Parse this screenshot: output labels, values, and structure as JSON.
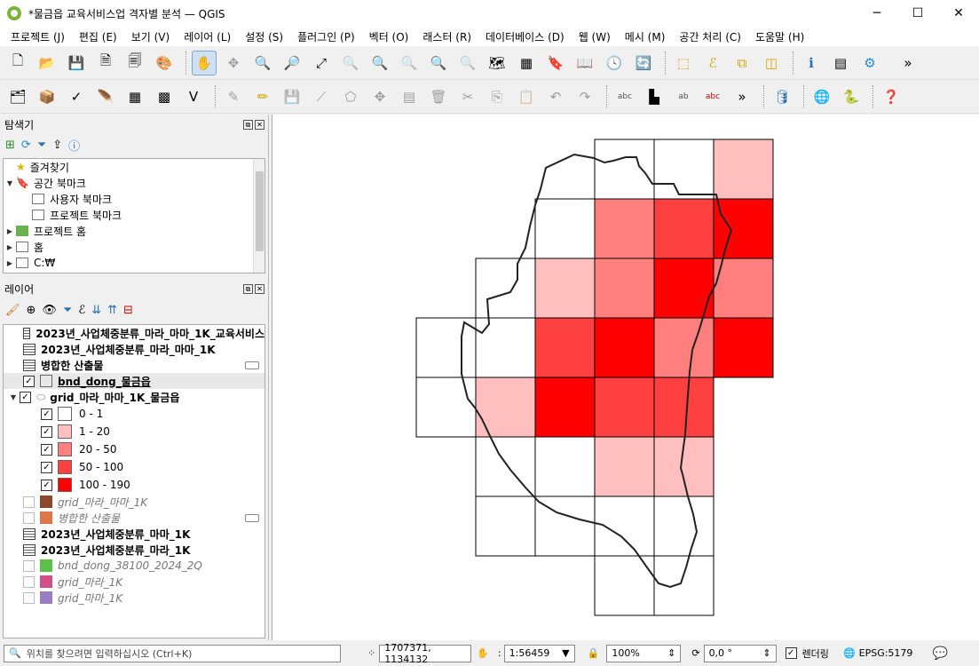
{
  "window": {
    "title": "*물금읍 교육서비스업 격자별 분석 — QGIS"
  },
  "menu": [
    "프로젝트 (J)",
    "편집 (E)",
    "보기 (V)",
    "레이어 (L)",
    "설정 (S)",
    "플러그인 (P)",
    "벡터 (O)",
    "래스터 (R)",
    "데이터베이스 (D)",
    "웹 (W)",
    "메시 (M)",
    "공간 처리 (C)",
    "도움말 (H)"
  ],
  "browser_panel": {
    "title": "탐색기",
    "items": [
      "즐겨찾기",
      "공간 북마크",
      "사용자 북마크",
      "프로젝트 북마크",
      "프로젝트 홈",
      "홈",
      "C:₩"
    ]
  },
  "layers_panel": {
    "title": "레이어",
    "layers": [
      {
        "name": "2023년_사업체중분류_마라_마마_1K_교육서비스",
        "style": "bold"
      },
      {
        "name": "2023년_사업체중분류_마라_마마_1K",
        "style": "bold"
      },
      {
        "name": "병합한 산출물",
        "style": "bold"
      },
      {
        "name": "bnd_dong_물금읍",
        "style": "bold-underline"
      },
      {
        "name": "grid_마라_마마_1K_물금읍",
        "style": "bold"
      },
      {
        "name": "grid_마라_마마_1K",
        "style": "italic",
        "color": "#8b4a2b"
      },
      {
        "name": "병합한 산출물",
        "style": "italic",
        "color": "#e0744a"
      },
      {
        "name": "2023년_사업체중분류_마마_1K",
        "style": "bold"
      },
      {
        "name": "2023년_사업체중분류_마라_1K",
        "style": "bold"
      },
      {
        "name": "bnd_dong_38100_2024_2Q",
        "style": "italic",
        "color": "#5cc04a"
      },
      {
        "name": "grid_마라_1K",
        "style": "italic",
        "color": "#d0508a"
      },
      {
        "name": "grid_마마_1K",
        "style": "italic",
        "color": "#9b7ec2"
      }
    ],
    "legend": [
      {
        "label": "0 - 1",
        "color": "#ffffff"
      },
      {
        "label": "1 - 20",
        "color": "#ffbfbf"
      },
      {
        "label": "20 - 50",
        "color": "#ff7f7f"
      },
      {
        "label": "50 - 100",
        "color": "#ff4040"
      },
      {
        "label": "100 - 190",
        "color": "#ff0000"
      }
    ]
  },
  "status": {
    "locator_placeholder": "위치를 찾으려면 입력하십시오 (Ctrl+K)",
    "coordinate": "1707371, 1134132",
    "scale": "1:56459",
    "magnifier": "100%",
    "rotation": "0,0 °",
    "render_label": "렌더링",
    "crs": "EPSG:5179"
  },
  "grid_cells": [
    {
      "row": 0,
      "col": 3,
      "cls": 0
    },
    {
      "row": 0,
      "col": 4,
      "cls": 0
    },
    {
      "row": 0,
      "col": 5,
      "cls": 1
    },
    {
      "row": 1,
      "col": 2,
      "cls": 0
    },
    {
      "row": 1,
      "col": 3,
      "cls": 2
    },
    {
      "row": 1,
      "col": 4,
      "cls": 3
    },
    {
      "row": 1,
      "col": 5,
      "cls": 4
    },
    {
      "row": 2,
      "col": 1,
      "cls": 0
    },
    {
      "row": 2,
      "col": 2,
      "cls": 1
    },
    {
      "row": 2,
      "col": 3,
      "cls": 2
    },
    {
      "row": 2,
      "col": 4,
      "cls": 4
    },
    {
      "row": 2,
      "col": 5,
      "cls": 2
    },
    {
      "row": 3,
      "col": 0,
      "cls": 0
    },
    {
      "row": 3,
      "col": 1,
      "cls": 0
    },
    {
      "row": 3,
      "col": 2,
      "cls": 3
    },
    {
      "row": 3,
      "col": 3,
      "cls": 4
    },
    {
      "row": 3,
      "col": 4,
      "cls": 2
    },
    {
      "row": 3,
      "col": 5,
      "cls": 4
    },
    {
      "row": 4,
      "col": 0,
      "cls": 0
    },
    {
      "row": 4,
      "col": 1,
      "cls": 1
    },
    {
      "row": 4,
      "col": 2,
      "cls": 4
    },
    {
      "row": 4,
      "col": 3,
      "cls": 3
    },
    {
      "row": 4,
      "col": 4,
      "cls": 3
    },
    {
      "row": 5,
      "col": 1,
      "cls": 0
    },
    {
      "row": 5,
      "col": 2,
      "cls": 0
    },
    {
      "row": 5,
      "col": 3,
      "cls": 1
    },
    {
      "row": 5,
      "col": 4,
      "cls": 1
    },
    {
      "row": 6,
      "col": 1,
      "cls": 0
    },
    {
      "row": 6,
      "col": 2,
      "cls": 0
    },
    {
      "row": 6,
      "col": 3,
      "cls": 0
    },
    {
      "row": 6,
      "col": 4,
      "cls": 0
    },
    {
      "row": 7,
      "col": 3,
      "cls": 0
    },
    {
      "row": 7,
      "col": 4,
      "cls": 0
    }
  ]
}
